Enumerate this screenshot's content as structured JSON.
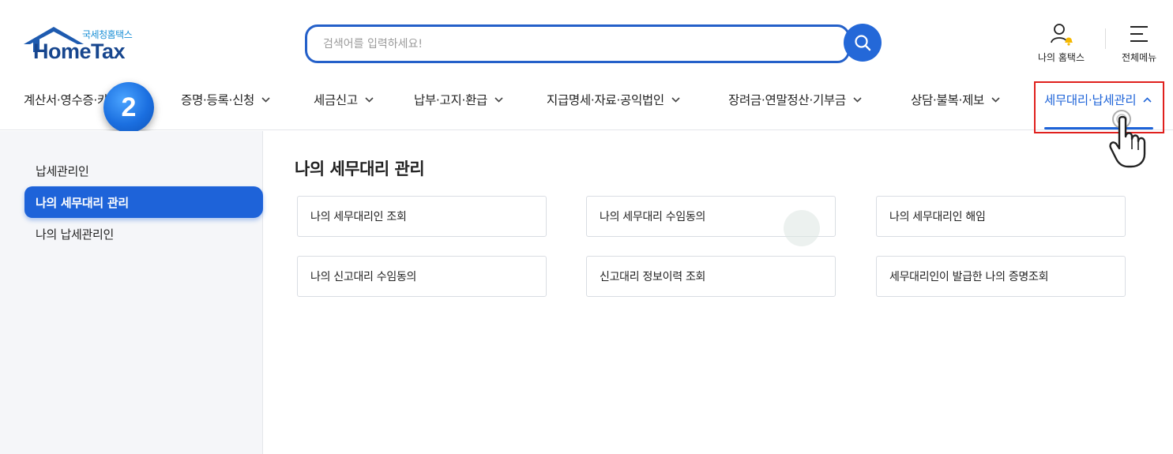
{
  "brand": {
    "sub_name": "국세청홈택스",
    "name": "HomeTax"
  },
  "search": {
    "placeholder": "검색어를 입력하세요!",
    "value": ""
  },
  "utilities": {
    "my_hometax_label": "나의 홈택스",
    "all_menu_label": "전체메뉴"
  },
  "gnb": {
    "items": [
      {
        "label": "계산서·영수증·카드"
      },
      {
        "label": "증명·등록·신청"
      },
      {
        "label": "세금신고"
      },
      {
        "label": "납부·고지·환급"
      },
      {
        "label": "지급명세·자료·공익법인"
      },
      {
        "label": "장려금·연말정산·기부금"
      },
      {
        "label": "상담·불복·제보"
      },
      {
        "label": "세무대리·납세관리"
      }
    ],
    "active_index": 7
  },
  "step_badge": "2",
  "sidebar": {
    "items": [
      {
        "label": "납세관리인"
      },
      {
        "label": "나의 세무대리 관리"
      },
      {
        "label": "나의 납세관리인"
      }
    ],
    "active_index": 1
  },
  "main": {
    "title": "나의 세무대리 관리",
    "cards": [
      {
        "label": "나의 세무대리인 조회"
      },
      {
        "label": "나의 세무대리 수임동의"
      },
      {
        "label": "나의 세무대리인 해임"
      },
      {
        "label": "나의 신고대리 수임동의"
      },
      {
        "label": "신고대리 정보이력 조회"
      },
      {
        "label": "세무대리인이 발급한 나의 증명조회"
      }
    ]
  },
  "colors": {
    "accent": "#1d63d8",
    "highlight_box": "#e0201d",
    "brand_dark": "#17468e",
    "brand_light": "#1a8fd6"
  },
  "icons": {
    "search": "search-icon",
    "user_bell": "user-bell-icon",
    "menu": "hamburger-menu-icon",
    "pointer": "pointing-hand-icon"
  }
}
